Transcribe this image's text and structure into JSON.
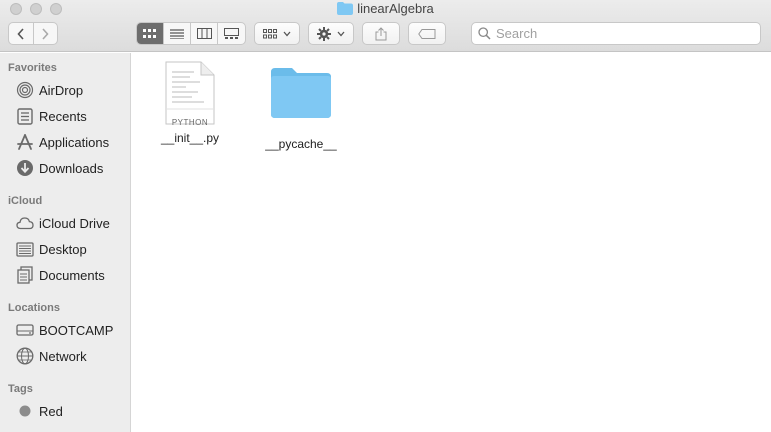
{
  "window": {
    "title": "linearAlgebra"
  },
  "toolbar": {
    "back_icon": "chevron-left-icon",
    "forward_icon": "chevron-right-icon",
    "view_modes": [
      "icon-view",
      "list-view",
      "column-view",
      "gallery-view"
    ],
    "active_view": "icon-view",
    "group_icon": "group-grid-icon",
    "action_icon": "gear-icon",
    "share_icon": "share-icon",
    "tag_icon": "tag-icon"
  },
  "search": {
    "placeholder": "Search"
  },
  "sidebar": {
    "favorites_header": "Favorites",
    "favorites": [
      {
        "label": "AirDrop",
        "icon": "airdrop-icon"
      },
      {
        "label": "Recents",
        "icon": "recents-icon"
      },
      {
        "label": "Applications",
        "icon": "applications-icon"
      },
      {
        "label": "Downloads",
        "icon": "downloads-icon"
      }
    ],
    "icloud_header": "iCloud",
    "icloud": [
      {
        "label": "iCloud Drive",
        "icon": "cloud-icon"
      },
      {
        "label": "Desktop",
        "icon": "desktop-icon"
      },
      {
        "label": "Documents",
        "icon": "documents-icon"
      }
    ],
    "locations_header": "Locations",
    "locations": [
      {
        "label": "BOOTCAMP",
        "icon": "disk-icon"
      },
      {
        "label": "Network",
        "icon": "network-icon"
      }
    ],
    "tags_header": "Tags",
    "tags": [
      {
        "label": "Red",
        "icon": "tag-dot-icon"
      }
    ]
  },
  "files": [
    {
      "name": "__init__.py",
      "badge": "PYTHON",
      "icon": "python-file-icon"
    },
    {
      "name": "__pycache__",
      "icon": "folder-icon"
    }
  ],
  "colors": {
    "folder": "#7fc8f3",
    "folder_tab": "#6bbcea",
    "active_view": "#6d6d6d"
  }
}
